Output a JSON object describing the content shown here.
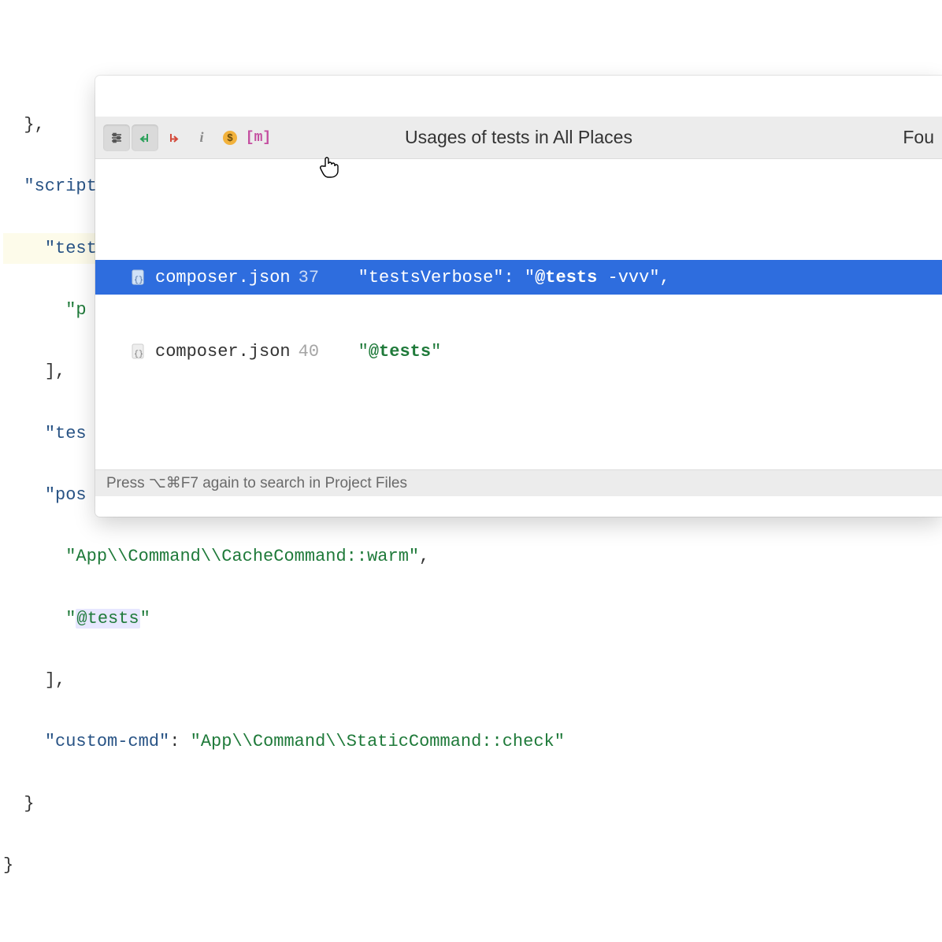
{
  "code": {
    "scripts_key": "\"scripts\"",
    "tests_key": "\"tests\"",
    "p_fragment": "\"p",
    "bracket_close": "],",
    "tes_fragment": "\"tes",
    "pos_fragment": "\"pos",
    "cache_cmd": "\"App\\\\Command\\\\CacheCommand::warm\"",
    "at_tests_pre": "\"",
    "at_tests_hl": "@tests",
    "at_tests_post": "\"",
    "bracket_close2": "],",
    "custom_key": "\"custom-cmd\"",
    "custom_val": "\"App\\\\Command\\\\StaticCommand::check\""
  },
  "popup": {
    "title": "Usages of tests in All Places",
    "found": "Fou",
    "footer": "Press ⌥⌘F7 again to search in Project Files",
    "toolbar": {
      "settings": "settings",
      "prev": "prev",
      "next": "next",
      "info": "info",
      "dollar": "dollar",
      "m": "m"
    },
    "rows": [
      {
        "file": "composer.json",
        "line": "37",
        "snippet_key": "\"testsVerbose\"",
        "snippet_pre": "\"",
        "snippet_bold": "@tests",
        "snippet_rest": " -vvv\",",
        "selected": true
      },
      {
        "file": "composer.json",
        "line": "40",
        "snippet_pre": "\"",
        "snippet_bold": "@tests",
        "snippet_rest": "\"",
        "selected": false
      }
    ]
  }
}
